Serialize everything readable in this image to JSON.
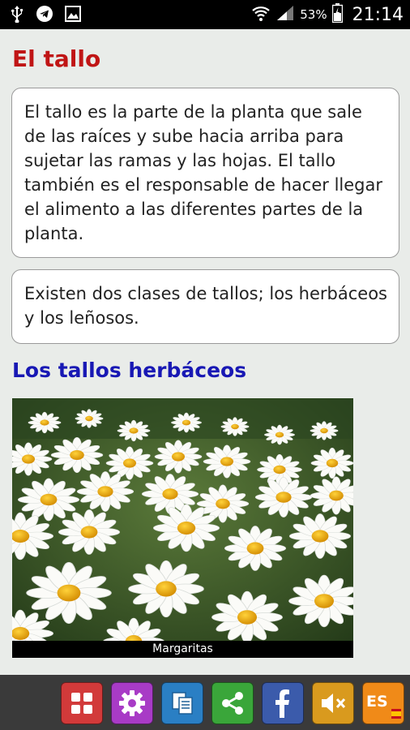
{
  "status_bar": {
    "battery_percent": "53%",
    "time": "21:14",
    "icons": [
      "usb-icon",
      "telegram-icon",
      "gallery-icon",
      "wifi-icon",
      "signal-icon",
      "battery-icon"
    ]
  },
  "page": {
    "title": "El tallo",
    "paragraph1": "El tallo es la parte de la planta que sale de las raíces y sube hacia arriba para sujetar las ramas y las hojas. El tallo también es el responsable de hacer llegar el alimento a las diferentes partes de la planta.",
    "paragraph2": "Existen dos clases de tallos; los herbáceos y los leñosos.",
    "section_heading": "Los tallos herbáceos",
    "image_caption": "Margaritas"
  },
  "toolbar": {
    "buttons": [
      {
        "icon": "menu-grid-icon",
        "color": "#d23a3a"
      },
      {
        "icon": "gear-icon",
        "color": "#a83bc6"
      },
      {
        "icon": "copy-icon",
        "color": "#2a7fc4"
      },
      {
        "icon": "share-icon",
        "color": "#3aa63a"
      },
      {
        "icon": "facebook-icon",
        "color": "#3b5bab"
      },
      {
        "icon": "mute-icon",
        "color": "#d99a1e"
      },
      {
        "icon": "language-icon",
        "color": "#f08a18"
      }
    ],
    "language_label": "ES"
  },
  "colors": {
    "title": "#c01515",
    "heading": "#1818b4",
    "background": "#e9ece9"
  }
}
